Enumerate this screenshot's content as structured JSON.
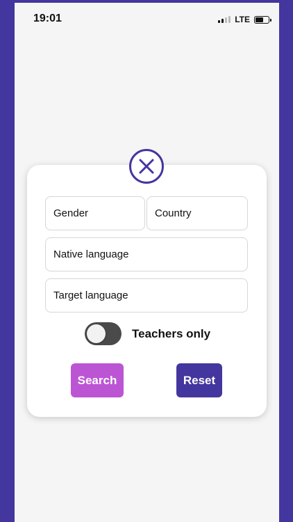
{
  "status_bar": {
    "time": "19:01",
    "network": "LTE",
    "battery_level": 0.55
  },
  "filter": {
    "close_icon": "close-x-icon",
    "fields": {
      "gender": "Gender",
      "country": "Country",
      "native_language": "Native language",
      "target_language": "Target language"
    },
    "teachers_only": {
      "label": "Teachers only",
      "enabled": false
    },
    "search_label": "Search",
    "reset_label": "Reset"
  },
  "colors": {
    "brand": "#43369e",
    "search_button": "#bc55d4",
    "toggle_off": "#4a4a4a",
    "background": "#f5f5f5"
  }
}
